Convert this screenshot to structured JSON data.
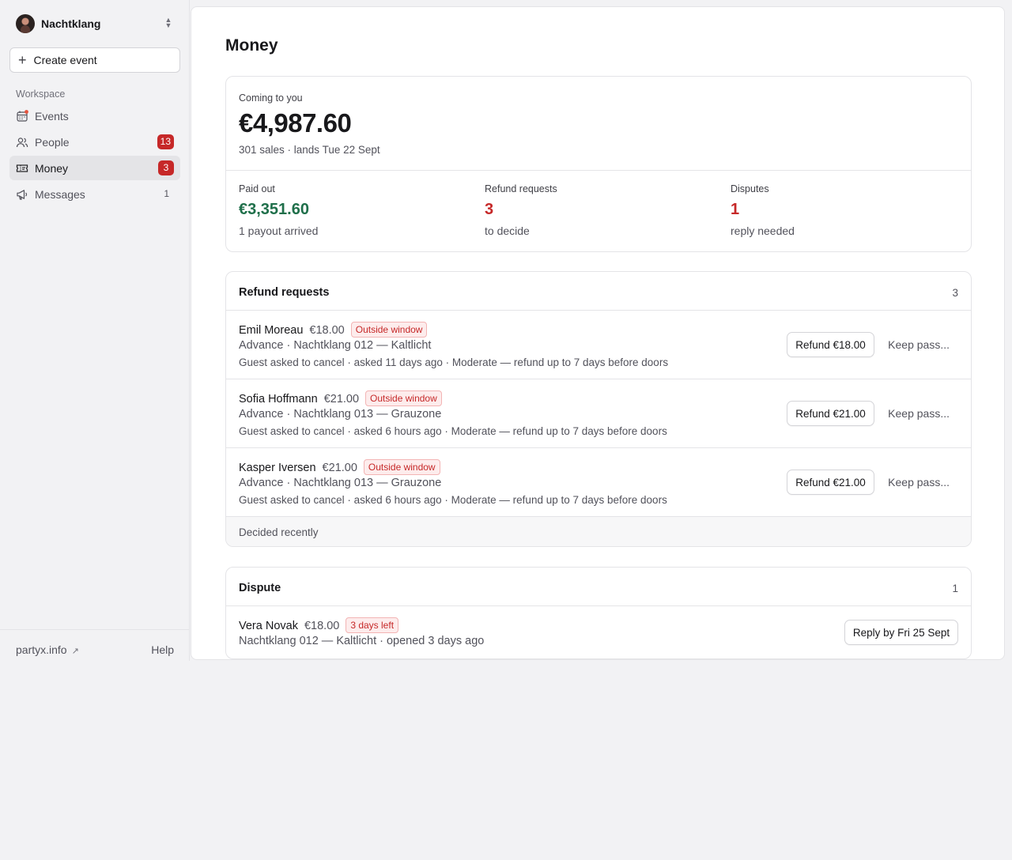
{
  "sidebar": {
    "org_name": "Nachtklang",
    "create_label": "Create event",
    "section_label": "Workspace",
    "items": [
      {
        "label": "Events",
        "icon": "calendar-icon",
        "badge": "",
        "count": ""
      },
      {
        "label": "People",
        "icon": "people-icon",
        "badge": "13",
        "count": ""
      },
      {
        "label": "Money",
        "icon": "ticket-icon",
        "badge": "3",
        "count": ""
      },
      {
        "label": "Messages",
        "icon": "megaphone-icon",
        "badge": "",
        "count": "1"
      }
    ],
    "footer_link": "partyx.info",
    "help": "Help"
  },
  "colors": {
    "accent_red": "#c62828",
    "paid_green": "#1f6f4a"
  },
  "main": {
    "title": "Money",
    "summary": {
      "coming_label": "Coming to you",
      "coming_amount": "€4,987.60",
      "coming_sub": "301 sales · lands Tue 22 Sept",
      "stats": [
        {
          "label": "Paid out",
          "value": "€3,351.60",
          "sub": "1 payout arrived"
        },
        {
          "label": "Refund requests",
          "value": "3",
          "sub": "to decide"
        },
        {
          "label": "Disputes",
          "value": "1",
          "sub": "reply needed"
        }
      ]
    },
    "refunds": {
      "title": "Refund requests",
      "count": "3",
      "rows": [
        {
          "name": "Emil Moreau",
          "amount": "€18.00",
          "tag": "Outside window",
          "line2": "Advance · Nachtklang 012 — Kaltlicht",
          "line3": "Guest asked to cancel · asked 11 days ago · Moderate — refund up to 7 days before doors",
          "button": "Refund €18.00",
          "keep": "Keep pass..."
        },
        {
          "name": "Sofia Hoffmann",
          "amount": "€21.00",
          "tag": "Outside window",
          "line2": "Advance · Nachtklang 013 — Grauzone",
          "line3": "Guest asked to cancel · asked 6 hours ago · Moderate — refund up to 7 days before doors",
          "button": "Refund €21.00",
          "keep": "Keep pass..."
        },
        {
          "name": "Kasper Iversen",
          "amount": "€21.00",
          "tag": "Outside window",
          "line2": "Advance · Nachtklang 013 — Grauzone",
          "line3": "Guest asked to cancel · asked 6 hours ago · Moderate — refund up to 7 days before doors",
          "button": "Refund €21.00",
          "keep": "Keep pass..."
        }
      ],
      "decided_label": "Decided recently"
    },
    "dispute": {
      "title": "Dispute",
      "count": "1",
      "name": "Vera Novak",
      "amount": "€18.00",
      "tag": "3 days left",
      "line2": "Nachtklang 012 — Kaltlicht · opened 3 days ago",
      "button": "Reply by Fri 25 Sept"
    }
  }
}
